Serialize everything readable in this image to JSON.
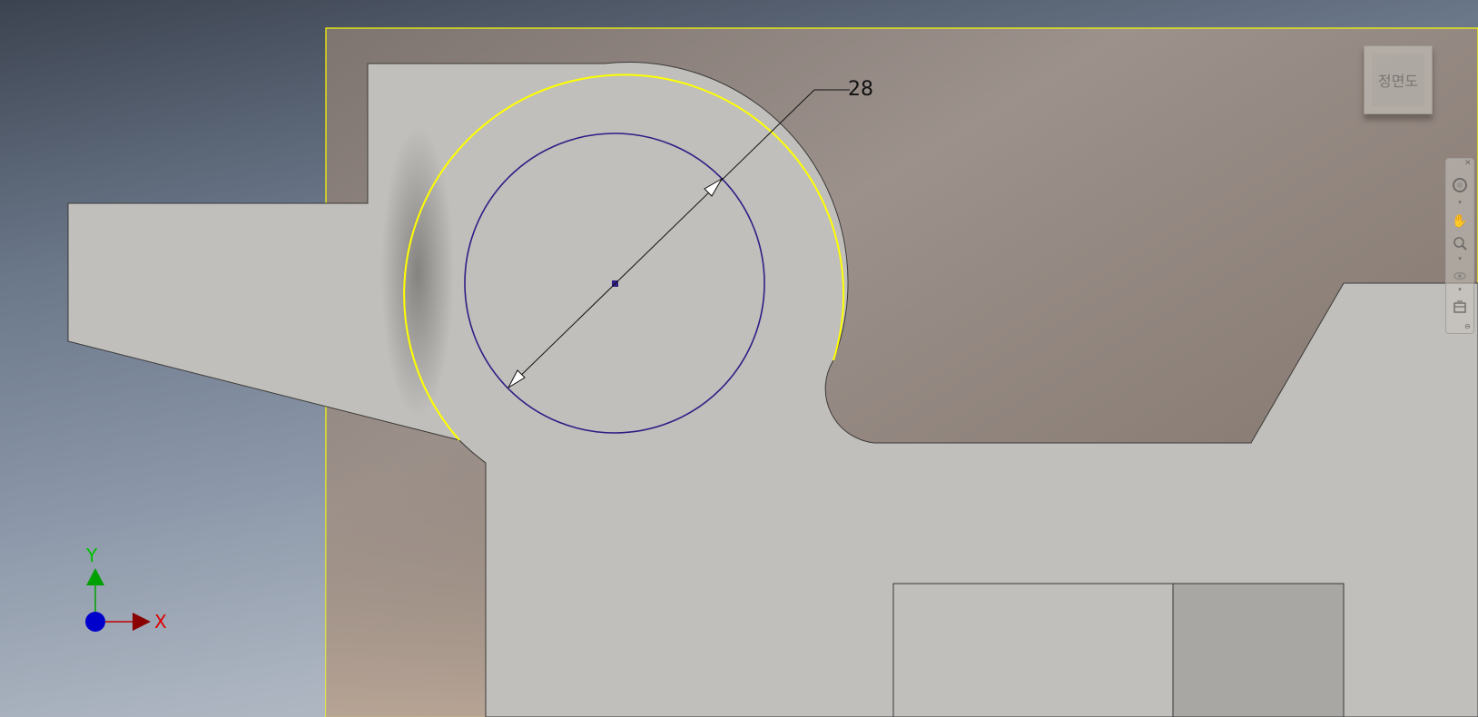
{
  "view_cube": {
    "face_label": "정면도"
  },
  "dimension": {
    "value": "28"
  },
  "axis_triad": {
    "x_label": "X",
    "y_label": "Y"
  },
  "nav_bar": {
    "tools": [
      {
        "icon": "steering-wheel-icon"
      },
      {
        "icon": "pan-hand-icon"
      },
      {
        "icon": "zoom-icon"
      },
      {
        "icon": "orbit-icon"
      },
      {
        "icon": "view-face-icon"
      }
    ]
  },
  "colors": {
    "sketch_plane": "#8f837b",
    "part_face": "#c0bfbb",
    "selection_highlight": "#ffff00",
    "circle": "#2e1d86",
    "x_axis": "#c00000",
    "y_axis": "#00a000",
    "origin": "#0000cc"
  }
}
